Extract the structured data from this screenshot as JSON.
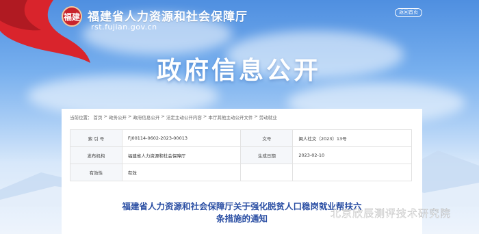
{
  "site": {
    "name": "福建省人力资源和社会保障厅",
    "url": "rst.fujian.gov.cn",
    "logo_text": "福建",
    "home_button": "返回首页"
  },
  "banner": {
    "title": "政府信息公开"
  },
  "breadcrumb": {
    "prefix": "当前位置：",
    "items": [
      "首页",
      "政务公开",
      "政府信息公开",
      "法定主动公开内容",
      "本厅其他主动公开文件",
      "劳动就业"
    ],
    "separator": ">"
  },
  "meta": {
    "rows": [
      [
        {
          "k": "索 引 号",
          "v": "FJ00114-0602-2023-00013"
        },
        {
          "k": "文号",
          "v": "闽人社文〔2023〕13号"
        }
      ],
      [
        {
          "k": "发布机构",
          "v": "福建省人力资源和社会保障厅"
        },
        {
          "k": "生成日期",
          "v": "2023-02-10"
        }
      ],
      [
        {
          "k": "有效性",
          "v": "有效"
        }
      ]
    ]
  },
  "document": {
    "title_line1": "福建省人力资源和社会保障厅关于强化脱贫人口稳岗就业帮扶六",
    "title_line2": "条措施的通知"
  },
  "watermark": {
    "text": "北京欣辰测评技术研究院",
    "icon": "wechat-icon"
  },
  "colors": {
    "banner_red": "#c8232c",
    "title_blue": "#2a4ea3",
    "sky": "#77afee"
  }
}
